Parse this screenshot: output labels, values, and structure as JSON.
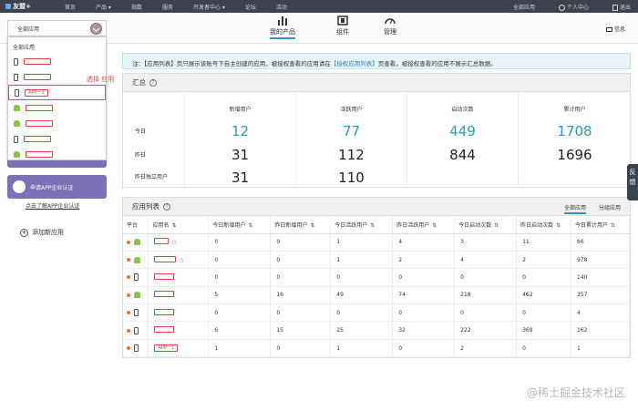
{
  "topnav": {
    "brand": "友盟+",
    "items": [
      "首页",
      "产品 ▾",
      "指数",
      "服务",
      "开发者中心 ▾",
      "论坛",
      "活动"
    ],
    "all_apps": "全部应用",
    "personal_center": "个人中心",
    "logout": "退出"
  },
  "subnav": {
    "tabs": [
      {
        "label": "我的产品",
        "icon": "bar-chart-icon"
      },
      {
        "label": "组件",
        "icon": "component-icon"
      },
      {
        "label": "管理",
        "icon": "gauge-icon"
      }
    ],
    "message": "信息"
  },
  "selector": {
    "value": "全部应用",
    "dropdown_all": "全部应用",
    "items": [
      {
        "platform": "ios",
        "label": ""
      },
      {
        "platform": "ios",
        "label": ""
      },
      {
        "platform": "ios",
        "label": "APP一1",
        "selected": true
      },
      {
        "platform": "android",
        "label": ""
      },
      {
        "platform": "android",
        "label": ""
      },
      {
        "platform": "ios",
        "label": ""
      },
      {
        "platform": "android",
        "label": ""
      }
    ],
    "annotation": "选择 应用"
  },
  "sidebar": {
    "cert_button": "申请APP企业认证",
    "cert_link": "点击了解APP企业认证",
    "add_app": "添加新应用"
  },
  "notice": {
    "prefix": "注：【应用列表】页只展示该账号下自主创建的应用，被授权查看的应用请在",
    "link": "【授权应用列表】",
    "suffix": "页查看，被授权查看的应用不展示汇总数据。"
  },
  "summary": {
    "title": "汇总",
    "columns": [
      "新增用户",
      "活跃用户",
      "启动次数",
      "累计用户"
    ],
    "rows": [
      {
        "label": "今日",
        "values": [
          "12",
          "77",
          "449",
          "1708"
        ]
      },
      {
        "label": "昨日",
        "values": [
          "31",
          "112",
          "844",
          "1696"
        ]
      },
      {
        "label": "昨日独立用户",
        "values": [
          "31",
          "110",
          "",
          ""
        ]
      }
    ]
  },
  "applist": {
    "title": "应用列表",
    "filter_all": "全部应用",
    "filter_group": "分组应用",
    "columns": [
      "平台",
      "应用名",
      "今日新增用户",
      "昨日新增用户",
      "今日活跃用户",
      "昨日活跃用户",
      "今日启动次数",
      "昨日启动次数",
      "今日累计用户"
    ],
    "rows": [
      {
        "platform": "android",
        "name": "",
        "star": true,
        "values": [
          "0",
          "0",
          "1",
          "4",
          "3",
          "11",
          "66"
        ]
      },
      {
        "platform": "android",
        "name": "",
        "star": true,
        "values": [
          "0",
          "0",
          "1",
          "2",
          "4",
          "2",
          "978"
        ]
      },
      {
        "platform": "ios",
        "name": "",
        "star": false,
        "values": [
          "0",
          "0",
          "0",
          "0",
          "0",
          "0",
          "140"
        ]
      },
      {
        "platform": "android",
        "name": "",
        "star": false,
        "values": [
          "5",
          "16",
          "49",
          "74",
          "218",
          "462",
          "357"
        ]
      },
      {
        "platform": "ios",
        "name": "",
        "star": false,
        "values": [
          "0",
          "0",
          "0",
          "0",
          "0",
          "0",
          "4"
        ]
      },
      {
        "platform": "ios",
        "name": "",
        "star": false,
        "values": [
          "6",
          "15",
          "25",
          "32",
          "222",
          "369",
          "162"
        ]
      },
      {
        "platform": "ios",
        "name": "APP一1",
        "star": false,
        "values": [
          "1",
          "0",
          "1",
          "0",
          "2",
          "0",
          "1"
        ]
      }
    ]
  },
  "side_tab": "反馈",
  "watermark": "@稀土掘金技术社区",
  "colors": {
    "accent": "#2d9bb5",
    "nav_bg": "#3d4250",
    "highlight_red": "#e04545",
    "cert_purple": "#7b72b5"
  }
}
